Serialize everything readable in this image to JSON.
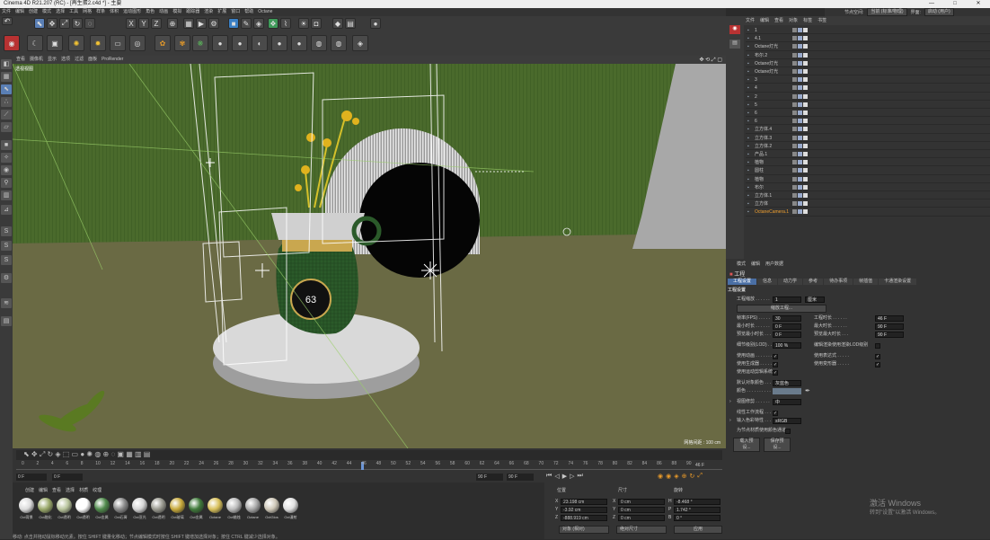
{
  "window": {
    "title": "Cinema 4D R21.207 (RC) - [再生蛋2.c4d *] - 主要",
    "controls": [
      "—",
      "□",
      "✕"
    ]
  },
  "menu": [
    "文件",
    "编辑",
    "创建",
    "模式",
    "选择",
    "工具",
    "网格",
    "样条",
    "体积",
    "运动图形",
    "角色",
    "动画",
    "模拟",
    "跟踪器",
    "渲染",
    "扩展",
    "窗口",
    "帮助",
    "Octane"
  ],
  "layout": {
    "label": "节点空间:",
    "node_space": "当前 (标准/物理)",
    "interface_label": "界面:",
    "interface_value": "启动 (用户)"
  },
  "viewport": {
    "menu": [
      "查看",
      "摄像机",
      "显示",
      "选项",
      "过滤",
      "面板",
      "ProRender"
    ],
    "camera": "透视视图",
    "stat": "网格间距 : 100 cm",
    "cup_label": "63"
  },
  "timeline": {
    "ticks": [
      "0",
      "2",
      "4",
      "6",
      "8",
      "10",
      "12",
      "14",
      "16",
      "18",
      "20",
      "22",
      "24",
      "26",
      "28",
      "30",
      "32",
      "34",
      "36",
      "38",
      "40",
      "42",
      "44",
      "46",
      "48",
      "50",
      "52",
      "54",
      "56",
      "58",
      "60",
      "62",
      "64",
      "66",
      "68",
      "70",
      "72",
      "74",
      "76",
      "78",
      "80",
      "82",
      "84",
      "86",
      "88",
      "90"
    ],
    "frame_end_label": "46 F",
    "start": "0 F",
    "current": "0 F",
    "end": "90 F",
    "end2": "90 F"
  },
  "materials": {
    "menu": [
      "创建",
      "编辑",
      "查看",
      "选择",
      "材质",
      "纹理"
    ],
    "items": [
      {
        "name": "Oct背景",
        "color": "#dcdcdc"
      },
      {
        "name": "Oct融化",
        "color": "#9aa96a"
      },
      {
        "name": "Oct透明",
        "color": "#b8c49c"
      },
      {
        "name": "Oct透明",
        "color": "#ffffff"
      },
      {
        "name": "Oct金属",
        "color": "#4f8a4b"
      },
      {
        "name": "Oct石膏",
        "color": "#8a8a8a"
      },
      {
        "name": "Oct亚光",
        "color": "#d4d4d4"
      },
      {
        "name": "Oct透明",
        "color": "#9a9a90"
      },
      {
        "name": "Oct玻璃",
        "color": "#c7a93a"
      },
      {
        "name": "Oct金属",
        "color": "#3f7a3a"
      },
      {
        "name": "Octane",
        "color": "#d8c05a"
      },
      {
        "name": "Oct蜡烛",
        "color": "#bbbbbb"
      },
      {
        "name": "Octane",
        "color": "#a8a8a8"
      },
      {
        "name": "OctGlos",
        "color": "#cfc8b8"
      },
      {
        "name": "Oct漫射",
        "color": "#e0e0e0"
      }
    ]
  },
  "coords": {
    "headers": [
      "位置",
      "尺寸",
      "旋转"
    ],
    "rows": [
      {
        "axis": "X",
        "pos": "23.198 cm",
        "size_axis": "X",
        "size": "0 cm",
        "rot_axis": "H",
        "rot": "-8.468 °"
      },
      {
        "axis": "Y",
        "pos": "-3.92 cm",
        "size_axis": "Y",
        "size": "0 cm",
        "rot_axis": "P",
        "rot": "1.742 °"
      },
      {
        "axis": "Z",
        "pos": "-888.919 cm",
        "size_axis": "Z",
        "size": "0 cm",
        "rot_axis": "B",
        "rot": "0 °"
      }
    ],
    "mode": "对象 (相对)",
    "size_mode": "绝对尺寸",
    "apply": "应用"
  },
  "objects": {
    "header": [
      "文件",
      "编辑",
      "查看",
      "对象",
      "标签",
      "书签"
    ],
    "rows": [
      {
        "name": "1"
      },
      {
        "name": "4.1"
      },
      {
        "name": "Octane灯光"
      },
      {
        "name": "布尔.2"
      },
      {
        "name": "Octane灯光"
      },
      {
        "name": "Octane灯光"
      },
      {
        "name": "3"
      },
      {
        "name": "4"
      },
      {
        "name": "2"
      },
      {
        "name": "5"
      },
      {
        "name": "6"
      },
      {
        "name": "6"
      },
      {
        "name": "立方体.4"
      },
      {
        "name": "立方体.3"
      },
      {
        "name": "立方体.2"
      },
      {
        "name": "产品.1"
      },
      {
        "name": "植物"
      },
      {
        "name": "圆柱"
      },
      {
        "name": "植物"
      },
      {
        "name": "布尔"
      },
      {
        "name": "立方体.1"
      },
      {
        "name": "立方体"
      },
      {
        "name": "OctaneCamera.1",
        "highlight": true
      }
    ]
  },
  "attributes": {
    "menu": [
      "模式",
      "编辑",
      "用户数据"
    ],
    "title": "工程",
    "tabs": [
      "工程设置",
      "信息",
      "动力学",
      "参考",
      "待办事项",
      "帧插值",
      "卡通渲染设置"
    ],
    "section": "工程设置",
    "scale_label": "工程缩放 . . . . . .",
    "scale_value": "1",
    "scale_unit": "厘米",
    "scale_btn": "缩放工程...",
    "fps_label": "帧率(FPS) . . . . .",
    "fps": "30",
    "min_label": "最小时长 . . . . . .",
    "min": "0 F",
    "pmin_label": "预览最小时长 . . .",
    "pmin": "0 F",
    "time_label": "工程时长 . . . . . .",
    "time": "46 F",
    "max_label": "最大时长 . . . . . .",
    "max": "90 F",
    "pmax_label": "预览最大时长 . . .",
    "pmax": "90 F",
    "lod_label": "细节级别(LOD) . .",
    "lod": "100 %",
    "render_lod": "编辑渲染使用渲染LOD级别",
    "anim_label": "使用动画 . . . . . . .",
    "expr_label": "使用表达式 . . . . .",
    "gen_label": "使用生成器 . . . . .",
    "deform_label": "使用变形器 . . . . .",
    "motion_label": "使用运动剪辑系统",
    "defcolor_label": "默认对象颜色 . . .",
    "defcolor": "灰蓝色",
    "color_label": "颜色 . . . . . . . . . .",
    "view_label": "视图修剪 . . . . . .",
    "view": "中",
    "linear_label": "线性工作流程 . . .",
    "input_label": "输入色彩特性 . . .",
    "input": "sRGB",
    "node_label": "为节点材质使用颜色通道",
    "btn_load": "载入预设...",
    "btn_save": "保存预设..."
  },
  "watermark": {
    "line1": "激活 Windows",
    "line2": "转到\"设置\"以激活 Windows。"
  },
  "status": "移动: 点击并拖动鼠标移动元素。按住 SHIFT 键量化移动；节点编辑模式时按住 SHIFT 键增加选择对象；按住 CTRL 键减少选择对象。"
}
